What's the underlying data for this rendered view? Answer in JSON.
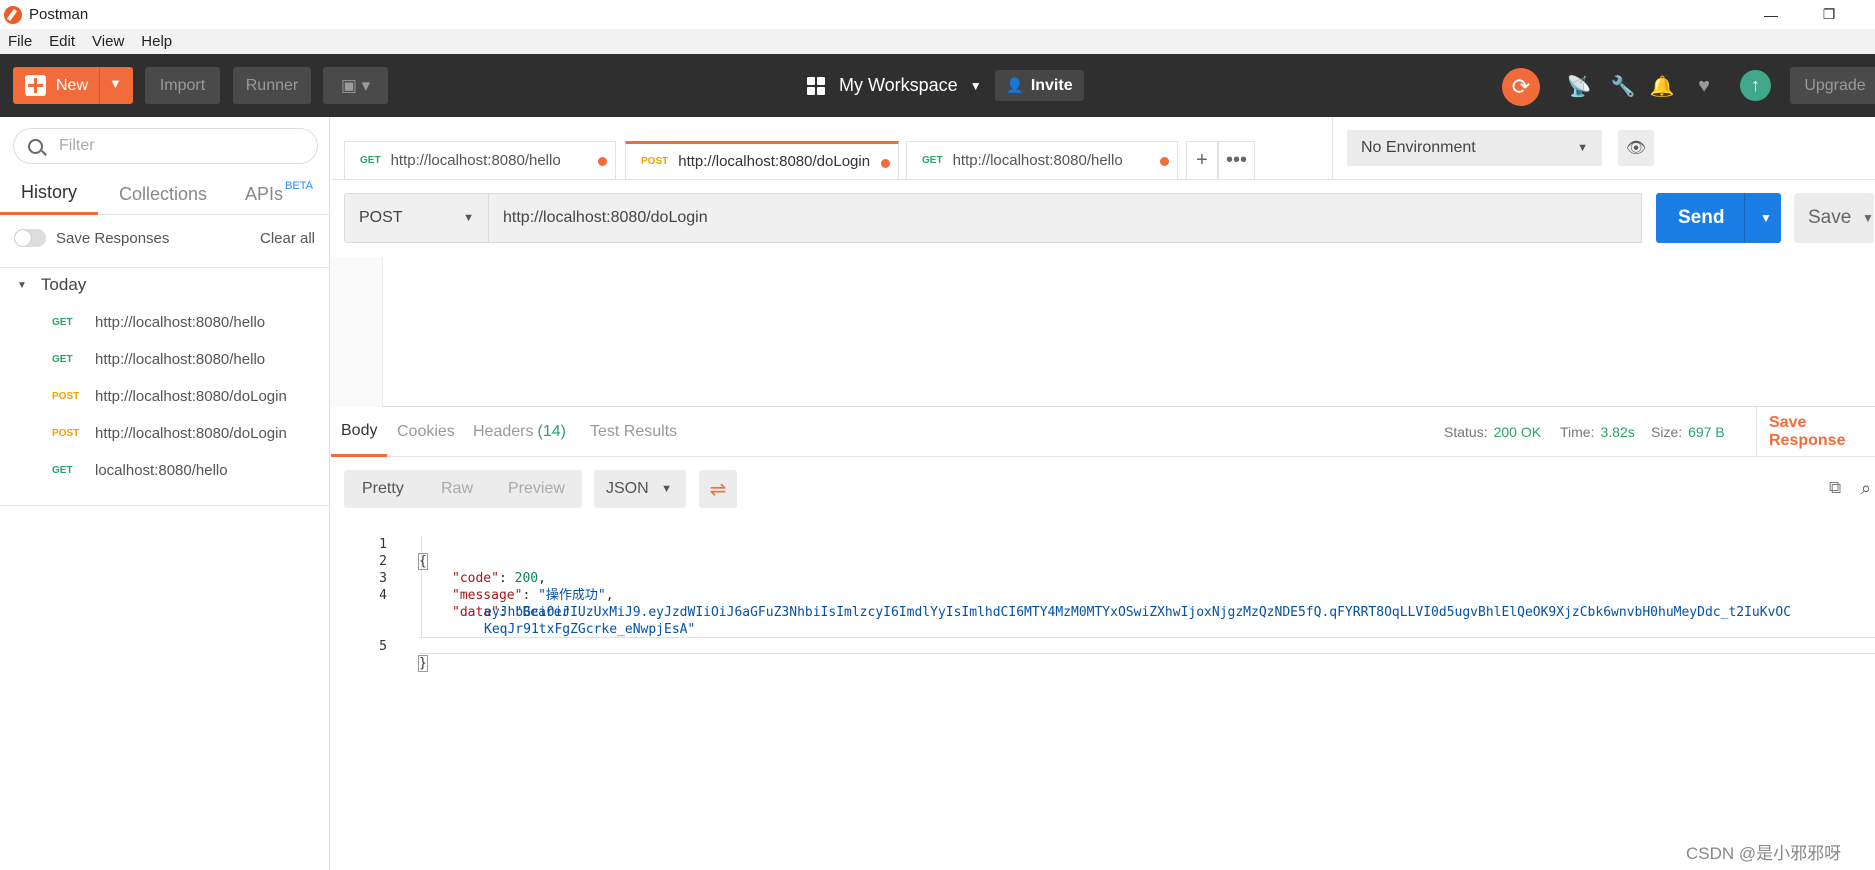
{
  "window": {
    "title": "Postman",
    "minimize_glyph": "—",
    "maximize_glyph": "❐"
  },
  "menu": [
    "File",
    "Edit",
    "View",
    "Help"
  ],
  "toolbar": {
    "new_label": "New",
    "import_label": "Import",
    "runner_label": "Runner",
    "workspace_label": "My Workspace",
    "invite_label": "Invite",
    "upgrade_label": "Upgrade",
    "accent_color": "#f26b3a"
  },
  "sidebar": {
    "filter_placeholder": "Filter",
    "tabs": {
      "history": "History",
      "collections": "Collections",
      "apis": "APIs",
      "apis_badge": "BETA"
    },
    "save_responses_label": "Save Responses",
    "clear_all_label": "Clear all",
    "group_label": "Today",
    "history": [
      {
        "method": "GET",
        "url": "http://localhost:8080/hello"
      },
      {
        "method": "GET",
        "url": "http://localhost:8080/hello"
      },
      {
        "method": "POST",
        "url": "http://localhost:8080/doLogin"
      },
      {
        "method": "POST",
        "url": "http://localhost:8080/doLogin"
      },
      {
        "method": "GET",
        "url": "localhost:8080/hello"
      }
    ]
  },
  "tabs": [
    {
      "method": "GET",
      "url": "http://localhost:8080/hello"
    },
    {
      "method": "POST",
      "url": "http://localhost:8080/doLogin"
    },
    {
      "method": "GET",
      "url": "http://localhost:8080/hello"
    }
  ],
  "environment": {
    "selected": "No Environment"
  },
  "request": {
    "method": "POST",
    "url": "http://localhost:8080/doLogin",
    "send_label": "Send",
    "save_label": "Save"
  },
  "response": {
    "tabs": {
      "body": "Body",
      "cookies": "Cookies",
      "headers": "Headers",
      "headers_count": "(14)",
      "tests": "Test Results"
    },
    "status_label": "Status:",
    "status_value": "200 OK",
    "time_label": "Time:",
    "time_value": "3.82s",
    "size_label": "Size:",
    "size_value": "697 B",
    "save_response_label": "Save Response",
    "view_modes": {
      "pretty": "Pretty",
      "raw": "Raw",
      "preview": "Preview"
    },
    "format": "JSON",
    "lines": {
      "l1": "1",
      "l2": "2",
      "l3": "3",
      "l4": "4",
      "l5": "5",
      "open_brace": "{",
      "code_key": "\"code\"",
      "code_colon": ": ",
      "code_val": "200",
      "code_comma": ",",
      "msg_key": "\"message\"",
      "msg_colon": ": ",
      "msg_val": "\"操作成功\"",
      "msg_comma": ",",
      "data_key": "\"data\"",
      "data_colon": ": ",
      "data_val1": "\"Bearer",
      "data_val2": "eyJhbGciOiJIUzUxMiJ9.eyJzdWIiOiJ6aGFuZ3NhbiIsImlzcyI6ImdlYyIsImlhdCI6MTY4MzM0MTYxOSwiZXhwIjoxNjgzMzQzNDE5fQ.qFYRRT8OqLLVI0d5ugvBhlElQeOK9XjzCbk6wnvbH0huMeyDdc_t2IuKvOC",
      "data_val3": "KeqJr91txFgZGcrke_eNwpjEsA\"",
      "close_brace": "}"
    }
  },
  "watermark": "CSDN @是小邪邪呀"
}
